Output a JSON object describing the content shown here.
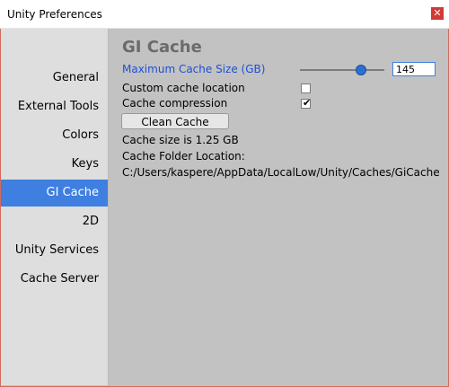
{
  "window": {
    "title": "Unity Preferences",
    "close_label": "✕"
  },
  "sidebar": {
    "items": [
      {
        "label": "General"
      },
      {
        "label": "External Tools"
      },
      {
        "label": "Colors"
      },
      {
        "label": "Keys"
      },
      {
        "label": "GI Cache"
      },
      {
        "label": "2D"
      },
      {
        "label": "Unity Services"
      },
      {
        "label": "Cache Server"
      }
    ],
    "selected_index": 4
  },
  "content": {
    "title": "GI Cache",
    "max_cache_size_label": "Maximum Cache Size (GB)",
    "max_cache_size_value": "145",
    "slider_level": 0.72,
    "custom_cache_location_label": "Custom cache location",
    "custom_cache_location_checked": false,
    "cache_compression_label": "Cache compression",
    "cache_compression_checked": true,
    "clean_cache_button": "Clean Cache",
    "cache_size_text": "Cache size is 1.25 GB",
    "cache_folder_location_label": "Cache Folder Location:",
    "cache_folder_path": "C:/Users/kaspere/AppData/LocalLow/Unity/Caches/GiCache"
  },
  "colors": {
    "selection": "#3e7fe0",
    "accent_text": "#1f4fd4",
    "close_button": "#d03a33"
  }
}
